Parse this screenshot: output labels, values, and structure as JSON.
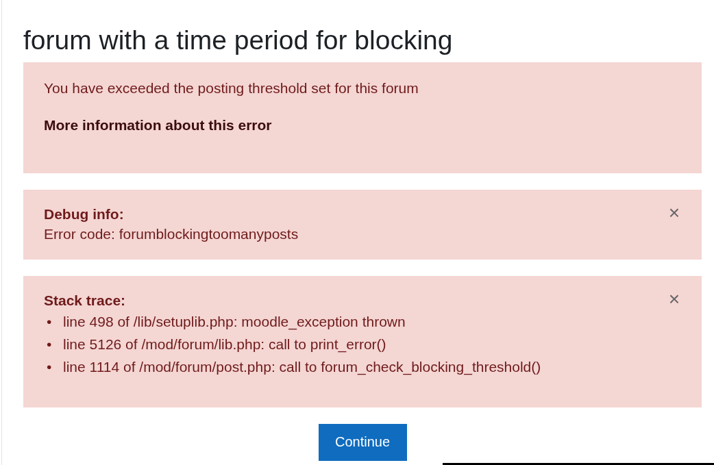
{
  "title": "forum with a time period for blocking",
  "error": {
    "message": "You have exceeded the posting threshold set for this forum",
    "more_info_link": "More information about this error"
  },
  "debug": {
    "heading": "Debug info:",
    "text": "Error code: forumblockingtoomanyposts",
    "close": "×"
  },
  "stack": {
    "heading": "Stack trace:",
    "close": "×",
    "lines": [
      {
        "bullet": "•",
        "text": "line 498 of /lib/setuplib.php: moodle_exception thrown"
      },
      {
        "bullet": "•",
        "text": "line 5126 of /mod/forum/lib.php: call to print_error()"
      },
      {
        "bullet": "•",
        "text": "line 1114 of /mod/forum/post.php: call to forum_check_blocking_threshold()"
      }
    ]
  },
  "button": "Continue"
}
